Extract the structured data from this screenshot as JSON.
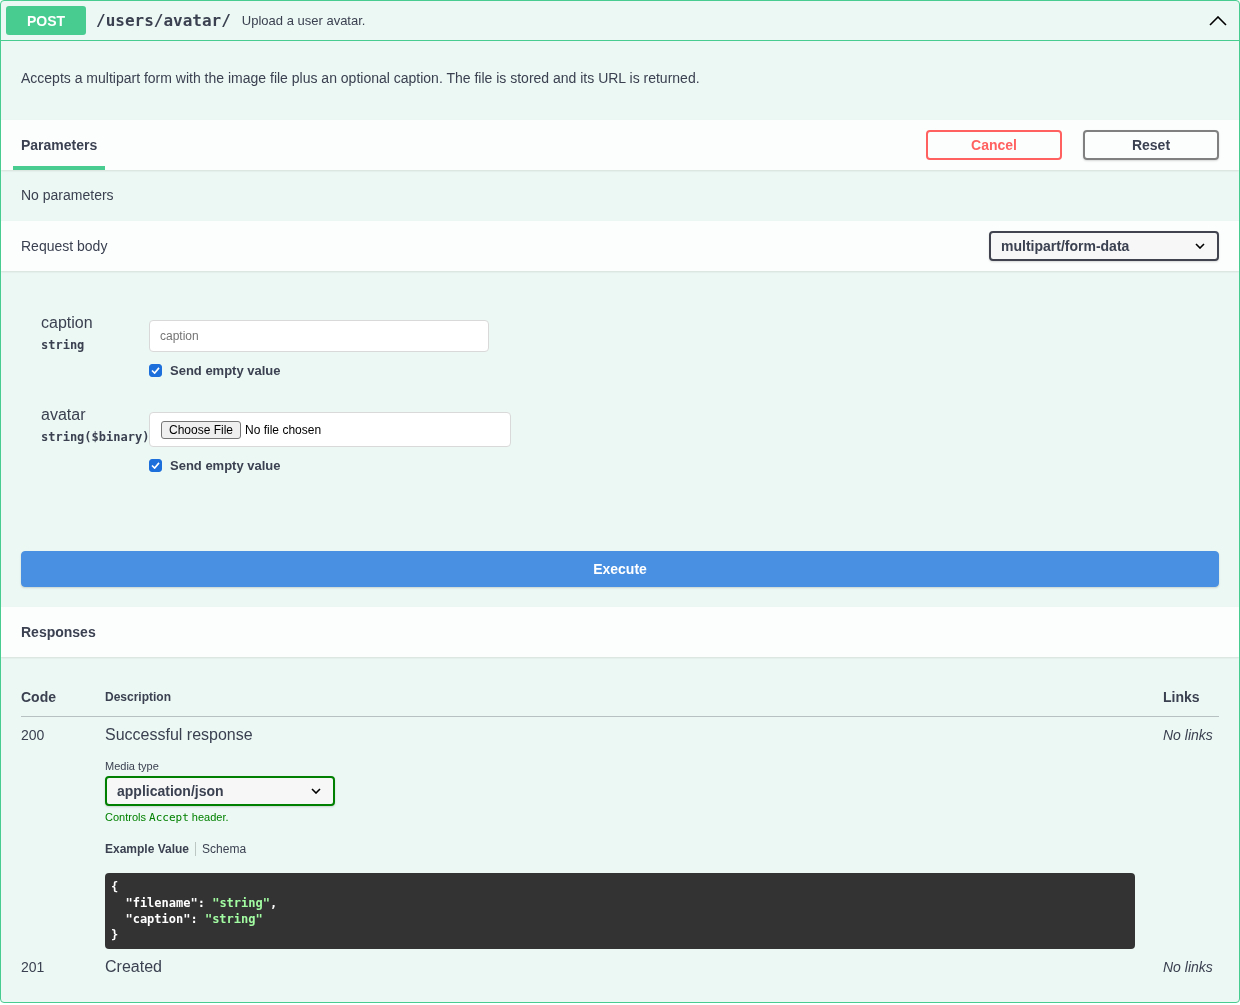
{
  "operation": {
    "method": "POST",
    "path": "/users/avatar/",
    "summary": "Upload a user avatar.",
    "expanded": true
  },
  "description": "Accepts a multipart form with the image file plus an optional caption. The file is stored and its URL is returned.",
  "parameters": {
    "tabs": [
      {
        "label": "Parameters",
        "selected": true
      }
    ],
    "actions": [
      {
        "label": "Cancel",
        "kind": "cancel"
      },
      {
        "label": "Reset",
        "kind": "reset"
      }
    ],
    "empty_text": "No parameters"
  },
  "request_body": {
    "title": "Request body",
    "content_type": "multipart/form-data",
    "fields": [
      {
        "name": "caption",
        "type": "string",
        "kind": "text",
        "placeholder": "caption",
        "send_empty": {
          "label": "Send empty value",
          "checked": true
        }
      },
      {
        "name": "avatar",
        "type": "string($binary)",
        "kind": "file",
        "button": "Choose File",
        "status": "No file chosen",
        "send_empty": {
          "label": "Send empty value",
          "checked": true
        }
      }
    ]
  },
  "execute": {
    "label": "Execute"
  },
  "responses": {
    "title": "Responses",
    "columns": [
      "Code",
      "Description",
      "Links"
    ],
    "rows": [
      {
        "code": "200",
        "description": "Successful response",
        "links": "No links",
        "media": {
          "label": "Media type",
          "value": "application/json",
          "hint": {
            "before": "Controls",
            "code": "Accept",
            "after": "header."
          }
        },
        "example": {
          "tabs": [
            {
              "label": "Example Value",
              "selected": true
            },
            {
              "label": "Schema",
              "selected": false
            }
          ],
          "lines": [
            [
              {
                "text": "{",
                "kind": "plain"
              }
            ],
            [
              {
                "text": "  \"filename\": ",
                "kind": "plain"
              },
              {
                "text": "\"string\"",
                "kind": "string"
              },
              {
                "text": ",",
                "kind": "plain"
              }
            ],
            [
              {
                "text": "  \"caption\": ",
                "kind": "plain"
              },
              {
                "text": "\"string\"",
                "kind": "string"
              }
            ],
            [
              {
                "text": "}",
                "kind": "plain"
              }
            ]
          ]
        }
      },
      {
        "code": "201",
        "description": "Created",
        "links": "No links"
      }
    ]
  }
}
